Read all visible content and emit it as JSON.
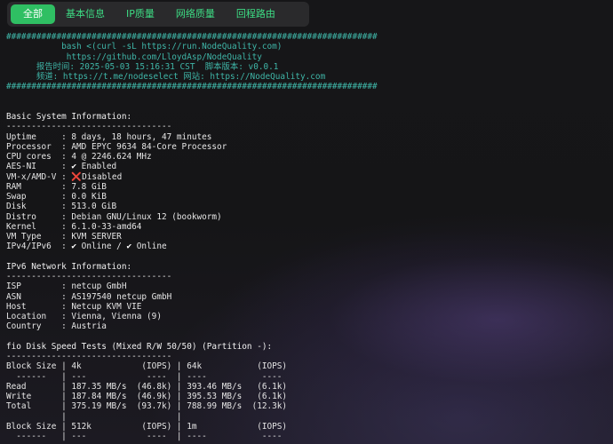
{
  "tabs": [
    {
      "label": "全部",
      "active": true
    },
    {
      "label": "基本信息",
      "active": false
    },
    {
      "label": "IP质量",
      "active": false
    },
    {
      "label": "网络质量",
      "active": false
    },
    {
      "label": "回程路由",
      "active": false
    }
  ],
  "header": {
    "rule": "##########################################################################",
    "line1": "           bash <(curl -sL https://run.NodeQuality.com)",
    "line2": "            https://github.com/LloydAsp/NodeQuality",
    "line3": "      报告时间: 2025-05-03 15:16:31 CST  脚本版本: v0.0.1",
    "line4": "      频道: https://t.me/nodeselect 网站: https://NodeQuality.com"
  },
  "basic": {
    "title": "Basic System Information:",
    "rule": "---------------------------------",
    "rows": [
      {
        "k": "Uptime     : ",
        "v": "8 days, 18 hours, 47 minutes"
      },
      {
        "k": "Processor  : ",
        "v": "AMD EPYC 9634 84-Core Processor"
      },
      {
        "k": "CPU cores  : ",
        "v": "4 @ 2246.624 MHz"
      },
      {
        "k": "AES-NI     : ",
        "icon": "✔",
        "v": " Enabled"
      },
      {
        "k": "VM-x/AMD-V : ",
        "cross": "❌",
        "v": "Disabled"
      },
      {
        "k": "RAM        : ",
        "v": "7.8 GiB"
      },
      {
        "k": "Swap       : ",
        "v": "0.0 KiB"
      },
      {
        "k": "Disk       : ",
        "v": "513.0 GiB"
      },
      {
        "k": "Distro     : ",
        "v": "Debian GNU/Linux 12 (bookworm)"
      },
      {
        "k": "Kernel     : ",
        "v": "6.1.0-33-amd64"
      },
      {
        "k": "VM Type    : ",
        "v": "KVM SERVER"
      },
      {
        "k": "IPv4/IPv6  : ",
        "icon": "✔",
        "v": " Online / ",
        "icon2": "✔",
        "v2": " Online"
      }
    ]
  },
  "ipv6": {
    "title": "IPv6 Network Information:",
    "rule": "---------------------------------",
    "rows": [
      {
        "k": "ISP        : ",
        "v": "netcup GmbH"
      },
      {
        "k": "ASN        : ",
        "v": "AS197540 netcup GmbH"
      },
      {
        "k": "Host       : ",
        "v": "Netcup KVM VIE"
      },
      {
        "k": "Location   : ",
        "v": "Vienna, Vienna (9)"
      },
      {
        "k": "Country    : ",
        "v": "Austria"
      }
    ]
  },
  "fio": {
    "title": "fio Disk Speed Tests (Mixed R/W 50/50) (Partition -):",
    "rule": "---------------------------------",
    "lines": [
      "Block Size | 4k            (IOPS) | 64k           (IOPS)",
      "  ------   | ---            ----  | ----           ----",
      "Read       | 187.35 MB/s  (46.8k) | 393.46 MB/s   (6.1k)",
      "Write      | 187.84 MB/s  (46.9k) | 395.53 MB/s   (6.1k)",
      "Total      | 375.19 MB/s  (93.7k) | 788.99 MB/s  (12.3k)",
      "           |                      |",
      "Block Size | 512k          (IOPS) | 1m            (IOPS)",
      "  ------   | ---            ----  | ----           ----"
    ]
  }
}
